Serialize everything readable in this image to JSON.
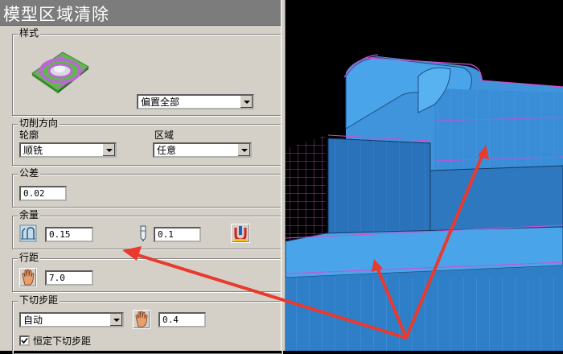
{
  "title": "模型区域清除",
  "style_group": {
    "legend": "样式",
    "preview_icon": "raster-style-preview-icon",
    "selected": "偏置全部"
  },
  "cut_direction": {
    "legend": "切削方向",
    "profile_label": "轮廓",
    "profile_value": "顺铣",
    "area_label": "区域",
    "area_value": "任意"
  },
  "tolerance": {
    "legend": "公差",
    "value": "0.02"
  },
  "allowance": {
    "legend": "余量",
    "radial_icon": "radial-allowance-icon",
    "radial_value": "0.15",
    "axial_icon": "axial-allowance-icon",
    "axial_value": "0.1",
    "component_icon": "component-allowance-icon"
  },
  "stepover": {
    "legend": "行距",
    "icon": "hand-icon",
    "value": "7.0"
  },
  "stepdown": {
    "legend": "下切步距",
    "mode": "自动",
    "icon": "hand-icon",
    "value": "0.4",
    "constant_label": "恒定下切步距",
    "constant_checked": true
  },
  "colors": {
    "panel": "#d4d0c8",
    "title_bar": "#7c7c7c",
    "model_blue": "#3a8ed8",
    "wire_magenta": "#d44cd4",
    "arrow_red": "#e83a2e"
  }
}
